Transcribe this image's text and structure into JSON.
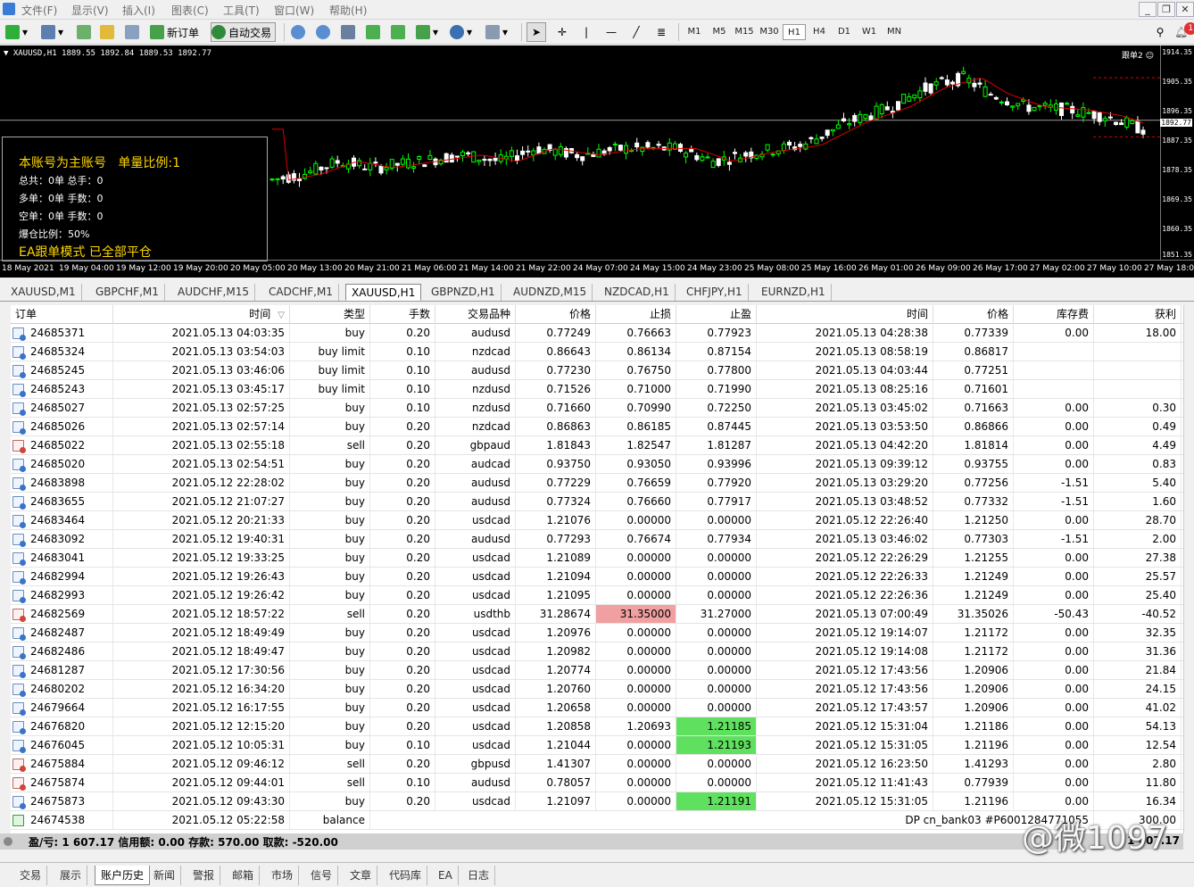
{
  "menu": [
    "文件(F)",
    "显示(V)",
    "插入(I)",
    "图表(C)",
    "工具(T)",
    "窗口(W)",
    "帮助(H)"
  ],
  "toolbar": {
    "new_order": "新订单",
    "auto_trade": "自动交易",
    "timeframes": [
      "M1",
      "M5",
      "M15",
      "M30",
      "H1",
      "H4",
      "D1",
      "W1",
      "MN"
    ],
    "active_timeframe": "H1",
    "notification_count": "1"
  },
  "chart": {
    "header": "XAUUSD,H1  1889.55 1892.84 1889.53 1892.77",
    "ea_label": "跟单2",
    "price_labels": [
      "1914.35",
      "1905.35",
      "1896.35",
      "1892.77",
      "1887.35",
      "1878.35",
      "1869.35",
      "1860.35",
      "1851.35"
    ],
    "current_price": "1892.77",
    "time_labels": [
      "18 May 2021",
      "19 May 04:00",
      "19 May 12:00",
      "19 May 20:00",
      "20 May 05:00",
      "20 May 13:00",
      "20 May 21:00",
      "21 May 06:00",
      "21 May 14:00",
      "21 May 22:00",
      "24 May 07:00",
      "24 May 15:00",
      "24 May 23:00",
      "25 May 08:00",
      "25 May 16:00",
      "26 May 01:00",
      "26 May 09:00",
      "26 May 17:00",
      "27 May 02:00",
      "27 May 10:00",
      "27 May 18:00"
    ],
    "colors": {
      "bull": "#00ff00",
      "bear": "#ffffff",
      "ma": "#e00000",
      "bg": "#000000"
    },
    "panel": {
      "line1a": "本账号为主账号",
      "line1b": "单量比例:1",
      "total": "总共：0单   总手：0",
      "buy": "多单：0单   手数：0",
      "sell": "空单：0单   手数：0",
      "margin": "爆仓比例：50%",
      "status": "EA跟单模式 已全部平仓"
    }
  },
  "chart_tabs": [
    "XAUUSD,M1",
    "GBPCHF,M1",
    "AUDCHF,M15",
    "CADCHF,M1",
    "XAUUSD,H1",
    "GBPNZD,H1",
    "AUDNZD,M15",
    "NZDCAD,H1",
    "CHFJPY,H1",
    "EURNZD,H1"
  ],
  "active_chart_tab": "XAUUSD,H1",
  "history": {
    "headers": [
      "订单",
      "时间",
      "类型",
      "手数",
      "交易品种",
      "价格",
      "止损",
      "止盈",
      "时间",
      "价格",
      "库存费",
      "获利"
    ],
    "sort_indicator": "▽",
    "rows": [
      [
        "24685371",
        "2021.05.13 04:03:35",
        "buy",
        "0.20",
        "audusd",
        "0.77249",
        "0.76663",
        "0.77923",
        "2021.05.13 04:28:38",
        "0.77339",
        "0.00",
        "18.00"
      ],
      [
        "24685324",
        "2021.05.13 03:54:03",
        "buy limit",
        "0.10",
        "nzdcad",
        "0.86643",
        "0.86134",
        "0.87154",
        "2021.05.13 08:58:19",
        "0.86817",
        "",
        ""
      ],
      [
        "24685245",
        "2021.05.13 03:46:06",
        "buy limit",
        "0.10",
        "audusd",
        "0.77230",
        "0.76750",
        "0.77800",
        "2021.05.13 04:03:44",
        "0.77251",
        "",
        ""
      ],
      [
        "24685243",
        "2021.05.13 03:45:17",
        "buy limit",
        "0.10",
        "nzdusd",
        "0.71526",
        "0.71000",
        "0.71990",
        "2021.05.13 08:25:16",
        "0.71601",
        "",
        ""
      ],
      [
        "24685027",
        "2021.05.13 02:57:25",
        "buy",
        "0.10",
        "nzdusd",
        "0.71660",
        "0.70990",
        "0.72250",
        "2021.05.13 03:45:02",
        "0.71663",
        "0.00",
        "0.30"
      ],
      [
        "24685026",
        "2021.05.13 02:57:14",
        "buy",
        "0.20",
        "nzdcad",
        "0.86863",
        "0.86185",
        "0.87445",
        "2021.05.13 03:53:50",
        "0.86866",
        "0.00",
        "0.49"
      ],
      [
        "24685022",
        "2021.05.13 02:55:18",
        "sell",
        "0.20",
        "gbpaud",
        "1.81843",
        "1.82547",
        "1.81287",
        "2021.05.13 04:42:20",
        "1.81814",
        "0.00",
        "4.49"
      ],
      [
        "24685020",
        "2021.05.13 02:54:51",
        "buy",
        "0.20",
        "audcad",
        "0.93750",
        "0.93050",
        "0.93996",
        "2021.05.13 09:39:12",
        "0.93755",
        "0.00",
        "0.83"
      ],
      [
        "24683898",
        "2021.05.12 22:28:02",
        "buy",
        "0.20",
        "audusd",
        "0.77229",
        "0.76659",
        "0.77920",
        "2021.05.13 03:29:20",
        "0.77256",
        "-1.51",
        "5.40"
      ],
      [
        "24683655",
        "2021.05.12 21:07:27",
        "buy",
        "0.20",
        "audusd",
        "0.77324",
        "0.76660",
        "0.77917",
        "2021.05.13 03:48:52",
        "0.77332",
        "-1.51",
        "1.60"
      ],
      [
        "24683464",
        "2021.05.12 20:21:33",
        "buy",
        "0.20",
        "usdcad",
        "1.21076",
        "0.00000",
        "0.00000",
        "2021.05.12 22:26:40",
        "1.21250",
        "0.00",
        "28.70"
      ],
      [
        "24683092",
        "2021.05.12 19:40:31",
        "buy",
        "0.20",
        "audusd",
        "0.77293",
        "0.76674",
        "0.77934",
        "2021.05.13 03:46:02",
        "0.77303",
        "-1.51",
        "2.00"
      ],
      [
        "24683041",
        "2021.05.12 19:33:25",
        "buy",
        "0.20",
        "usdcad",
        "1.21089",
        "0.00000",
        "0.00000",
        "2021.05.12 22:26:29",
        "1.21255",
        "0.00",
        "27.38"
      ],
      [
        "24682994",
        "2021.05.12 19:26:43",
        "buy",
        "0.20",
        "usdcad",
        "1.21094",
        "0.00000",
        "0.00000",
        "2021.05.12 22:26:33",
        "1.21249",
        "0.00",
        "25.57"
      ],
      [
        "24682993",
        "2021.05.12 19:26:42",
        "buy",
        "0.20",
        "usdcad",
        "1.21095",
        "0.00000",
        "0.00000",
        "2021.05.12 22:26:36",
        "1.21249",
        "0.00",
        "25.40"
      ],
      [
        "24682569",
        "2021.05.12 18:57:22",
        "sell",
        "0.20",
        "usdthb",
        "31.28674",
        "31.35000",
        "31.27000",
        "2021.05.13 07:00:49",
        "31.35026",
        "-50.43",
        "-40.52"
      ],
      [
        "24682487",
        "2021.05.12 18:49:49",
        "buy",
        "0.20",
        "usdcad",
        "1.20976",
        "0.00000",
        "0.00000",
        "2021.05.12 19:14:07",
        "1.21172",
        "0.00",
        "32.35"
      ],
      [
        "24682486",
        "2021.05.12 18:49:47",
        "buy",
        "0.20",
        "usdcad",
        "1.20982",
        "0.00000",
        "0.00000",
        "2021.05.12 19:14:08",
        "1.21172",
        "0.00",
        "31.36"
      ],
      [
        "24681287",
        "2021.05.12 17:30:56",
        "buy",
        "0.20",
        "usdcad",
        "1.20774",
        "0.00000",
        "0.00000",
        "2021.05.12 17:43:56",
        "1.20906",
        "0.00",
        "21.84"
      ],
      [
        "24680202",
        "2021.05.12 16:34:20",
        "buy",
        "0.20",
        "usdcad",
        "1.20760",
        "0.00000",
        "0.00000",
        "2021.05.12 17:43:56",
        "1.20906",
        "0.00",
        "24.15"
      ],
      [
        "24679664",
        "2021.05.12 16:17:55",
        "buy",
        "0.20",
        "usdcad",
        "1.20658",
        "0.00000",
        "0.00000",
        "2021.05.12 17:43:57",
        "1.20906",
        "0.00",
        "41.02"
      ],
      [
        "24676820",
        "2021.05.12 12:15:20",
        "buy",
        "0.20",
        "usdcad",
        "1.20858",
        "1.20693",
        "1.21185",
        "2021.05.12 15:31:04",
        "1.21186",
        "0.00",
        "54.13"
      ],
      [
        "24676045",
        "2021.05.12 10:05:31",
        "buy",
        "0.10",
        "usdcad",
        "1.21044",
        "0.00000",
        "1.21193",
        "2021.05.12 15:31:05",
        "1.21196",
        "0.00",
        "12.54"
      ],
      [
        "24675884",
        "2021.05.12 09:46:12",
        "sell",
        "0.20",
        "gbpusd",
        "1.41307",
        "0.00000",
        "0.00000",
        "2021.05.12 16:23:50",
        "1.41293",
        "0.00",
        "2.80"
      ],
      [
        "24675874",
        "2021.05.12 09:44:01",
        "sell",
        "0.10",
        "audusd",
        "0.78057",
        "0.00000",
        "0.00000",
        "2021.05.12 11:41:43",
        "0.77939",
        "0.00",
        "11.80"
      ],
      [
        "24675873",
        "2021.05.12 09:43:30",
        "buy",
        "0.20",
        "usdcad",
        "1.21097",
        "0.00000",
        "1.21191",
        "2021.05.12 15:31:05",
        "1.21196",
        "0.00",
        "16.34"
      ]
    ],
    "balance_row": {
      "order": "24674538",
      "time": "2021.05.12 05:22:58",
      "type": "balance",
      "comment": "DP cn_bank03 #P6001284771055",
      "profit": "300.00"
    },
    "summary": "盈/亏: 1 607.17  信用额: 0.00  存款: 570.00  取款: -520.00",
    "summary_right": "1 607.17"
  },
  "watermark": "@微1097",
  "bottom_tabs": [
    "交易",
    "展示",
    "账户历史",
    "新闻",
    "警报",
    "邮箱",
    "市场",
    "信号",
    "文章",
    "代码库",
    "EA",
    "日志"
  ],
  "active_bottom_tab": "账户历史"
}
